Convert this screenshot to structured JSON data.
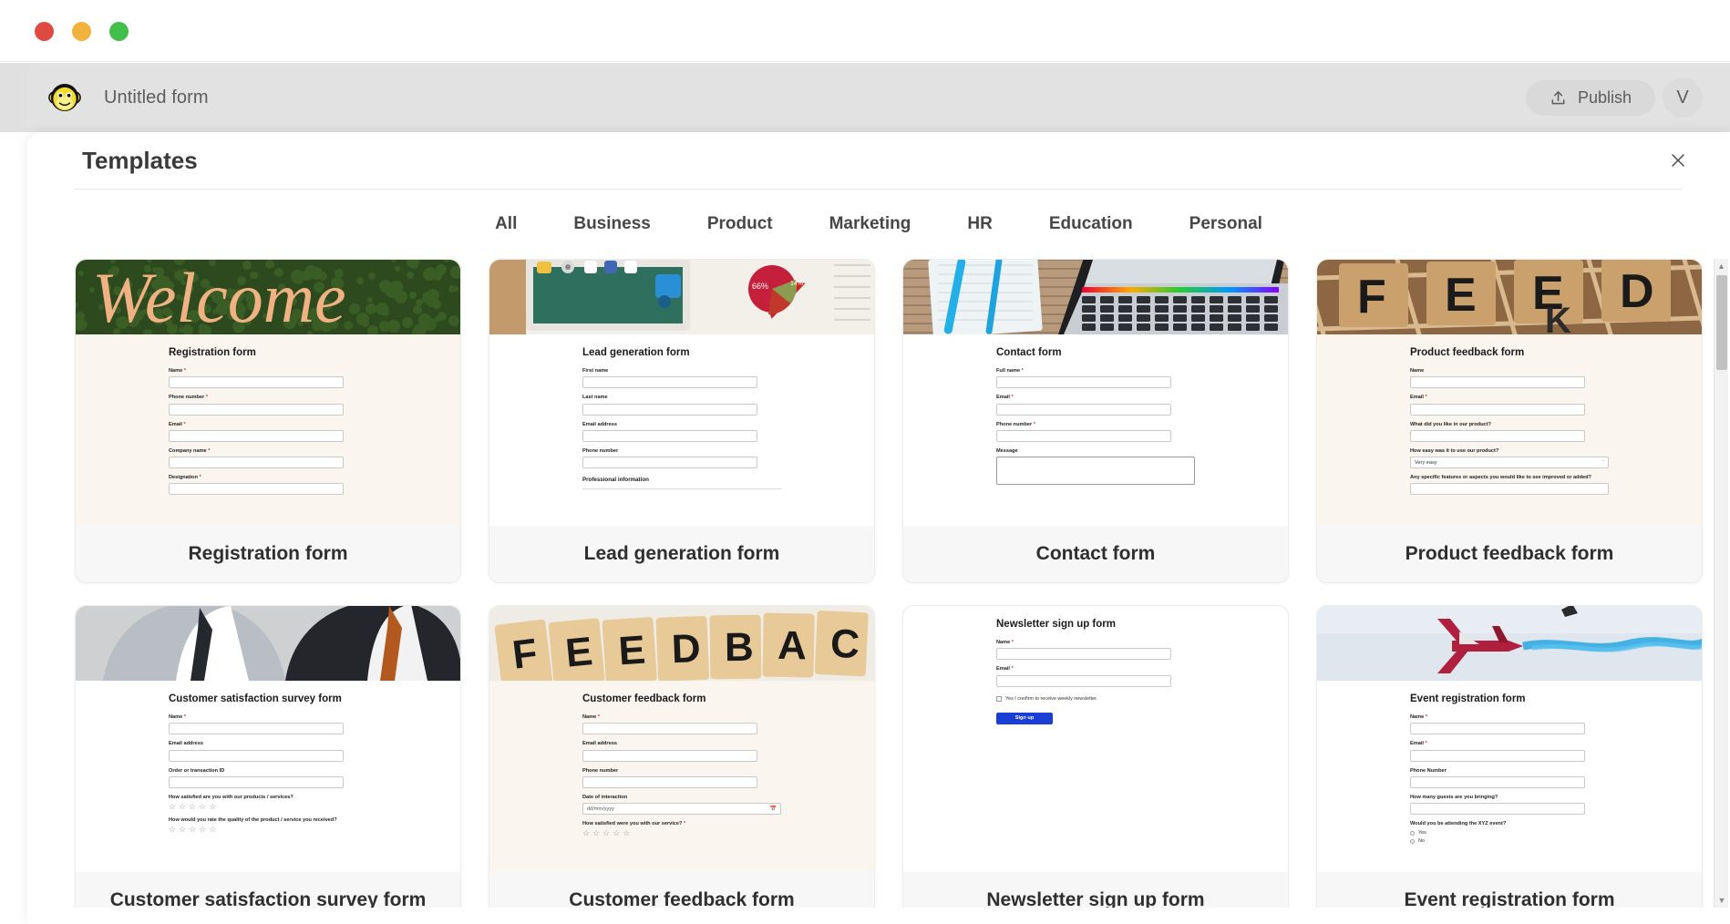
{
  "window": {
    "traffic_lights": [
      "close",
      "minimize",
      "maximize"
    ],
    "colors": {
      "red": "#dd4b43",
      "amber": "#f2b23e",
      "green": "#42be4b"
    }
  },
  "app_header": {
    "logo_name": "monkey-logo",
    "form_title": "Untitled form",
    "publish_label": "Publish",
    "avatar_initial": "V"
  },
  "modal": {
    "title": "Templates",
    "close_label": "✕"
  },
  "tabs": [
    {
      "label": "All",
      "active": true
    },
    {
      "label": "Business",
      "active": false
    },
    {
      "label": "Product",
      "active": false
    },
    {
      "label": "Marketing",
      "active": false
    },
    {
      "label": "HR",
      "active": false
    },
    {
      "label": "Education",
      "active": false
    },
    {
      "label": "Personal",
      "active": false
    }
  ],
  "templates": [
    {
      "label": "Registration form",
      "preview_title": "Registration form",
      "hero": "welcome-hedge-photo",
      "body_bg": "#faf5ef",
      "fields": [
        {
          "type": "text",
          "label": "Name",
          "required": true
        },
        {
          "type": "text",
          "label": "Phone number",
          "required": true
        },
        {
          "type": "text",
          "label": "Email",
          "required": true
        },
        {
          "type": "text",
          "label": "Company name",
          "required": true
        },
        {
          "type": "text",
          "label": "Designation",
          "required": true
        }
      ]
    },
    {
      "label": "Lead generation form",
      "preview_title": "Lead generation form",
      "hero": "tablet-charts-photo",
      "body_bg": "#ffffff",
      "fields": [
        {
          "type": "text",
          "label": "First name",
          "required": false
        },
        {
          "type": "text",
          "label": "Last name",
          "required": false
        },
        {
          "type": "text",
          "label": "Email address",
          "required": false
        },
        {
          "type": "text",
          "label": "Phone number",
          "required": false
        },
        {
          "type": "section",
          "label": "Professional information"
        }
      ]
    },
    {
      "label": "Contact form",
      "preview_title": "Contact form",
      "hero": "notebook-laptop-photo",
      "body_bg": "#ffffff",
      "fields": [
        {
          "type": "text",
          "label": "Full name",
          "required": true
        },
        {
          "type": "text",
          "label": "Email",
          "required": true
        },
        {
          "type": "text",
          "label": "Phone number",
          "required": true
        },
        {
          "type": "textarea",
          "label": "Message",
          "required": false
        }
      ]
    },
    {
      "label": "Product feedback form",
      "preview_title": "Product feedback form",
      "hero": "feedback-scrabble-photo",
      "body_bg": "#faf5ef",
      "fields": [
        {
          "type": "text",
          "label": "Name",
          "required": false
        },
        {
          "type": "text",
          "label": "Email",
          "required": true
        },
        {
          "type": "text",
          "label": "What did you like in our product?",
          "required": false
        },
        {
          "type": "select",
          "label": "How easy was it to use our product?",
          "value": "Very easy",
          "required": false
        },
        {
          "type": "text",
          "label": "Any specific features or aspects you would like to see improved or added?",
          "required": false,
          "wide": true
        }
      ]
    },
    {
      "label": "Customer satisfaction survey form",
      "preview_title": "Customer satisfaction survey form",
      "hero": "businessmen-suits-photo",
      "body_bg": "#ffffff",
      "fields": [
        {
          "type": "text",
          "label": "Name",
          "required": true
        },
        {
          "type": "text",
          "label": "Email address",
          "required": false
        },
        {
          "type": "text",
          "label": "Order or transaction ID",
          "required": false
        },
        {
          "type": "rating",
          "label": "How satisfied are you with our products / services?",
          "stars": 5,
          "required": false
        },
        {
          "type": "rating",
          "label": "How would you rate the quality of the product / service you received?",
          "stars": 5,
          "required": false
        }
      ]
    },
    {
      "label": "Customer feedback form",
      "preview_title": "Customer feedback form",
      "hero": "feedback-tiles-photo",
      "body_bg": "#faf5ef",
      "fields": [
        {
          "type": "text",
          "label": "Name",
          "required": true
        },
        {
          "type": "text",
          "label": "Email address",
          "required": false
        },
        {
          "type": "text",
          "label": "Phone number",
          "required": false
        },
        {
          "type": "date",
          "label": "Date of interaction",
          "value": "dd/mm/yyyy",
          "required": false
        },
        {
          "type": "rating",
          "label": "How satisfied were you with our service?",
          "stars": 5,
          "required": true
        }
      ]
    },
    {
      "label": "Newsletter sign up form",
      "preview_title": "Newsletter sign up form",
      "hero": "none",
      "body_bg": "#ffffff",
      "fields": [
        {
          "type": "text",
          "label": "Name",
          "required": true
        },
        {
          "type": "text",
          "label": "Email",
          "required": true
        },
        {
          "type": "checkbox",
          "label": "Yes I confirm to receive weekly newsletter.",
          "required": false
        },
        {
          "type": "button",
          "label": "Sign up",
          "color": "#1b3fd4"
        }
      ]
    },
    {
      "label": "Event registration form",
      "preview_title": "Event registration form",
      "hero": "red-jet-smoke-photo",
      "body_bg": "#ffffff",
      "fields": [
        {
          "type": "text",
          "label": "Name",
          "required": true
        },
        {
          "type": "text",
          "label": "Email",
          "required": true
        },
        {
          "type": "text",
          "label": "Phone Number",
          "required": false
        },
        {
          "type": "text",
          "label": "How many guests are you bringing?",
          "required": false
        },
        {
          "type": "radio",
          "label": "Would you be attending the XYZ event?",
          "options": [
            "Yes",
            "No"
          ],
          "required": false
        }
      ]
    }
  ],
  "scrollbar": {
    "up_arrow": "▲",
    "down_arrow": "▼",
    "position_percent": 8
  }
}
